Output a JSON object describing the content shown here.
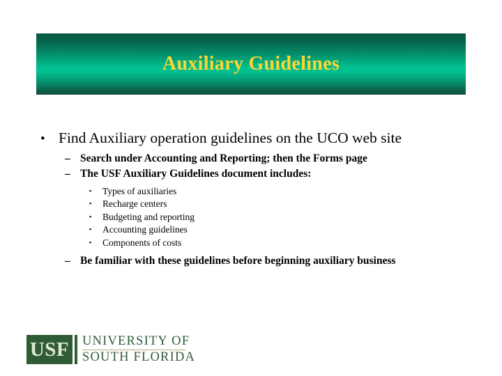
{
  "slide": {
    "background_color": "#ffffff",
    "title": {
      "text": "Auxiliary Guidelines",
      "text_color": "#ffd630",
      "banner_gradient_top": "#0a5741",
      "banner_gradient_mid": "#00c293",
      "banner_gradient_bottom": "#1b5448"
    },
    "content": {
      "level1": {
        "marker": "bullet-dot",
        "marker_glyph": "•",
        "text": "Find Auxiliary operation guidelines on the UCO web site"
      },
      "level2_items": [
        {
          "marker_glyph": "–",
          "text": "Search under Accounting and Reporting; then the Forms page"
        },
        {
          "marker_glyph": "–",
          "text": "The USF Auxiliary Guidelines document includes:"
        }
      ],
      "level3_items": [
        {
          "marker_glyph": "▪",
          "text": "Types of auxiliaries"
        },
        {
          "marker_glyph": "▪",
          "text": "Recharge centers"
        },
        {
          "marker_glyph": "▪",
          "text": "Budgeting and reporting"
        },
        {
          "marker_glyph": "▪",
          "text": "Accounting guidelines"
        },
        {
          "marker_glyph": "▪",
          "text": "Components of costs"
        }
      ],
      "level2_final": {
        "marker_glyph": "–",
        "text": "Be familiar with these guidelines before beginning auxiliary business"
      }
    },
    "logo": {
      "acronym": "USF",
      "line1": "UNIVERSITY OF",
      "line2": "SOUTH FLORIDA",
      "box_color": "#2f5b36",
      "acronym_color": "#dfe8cf",
      "word_color": "#2f5b36",
      "rule_color": "#b7ad7a"
    }
  }
}
